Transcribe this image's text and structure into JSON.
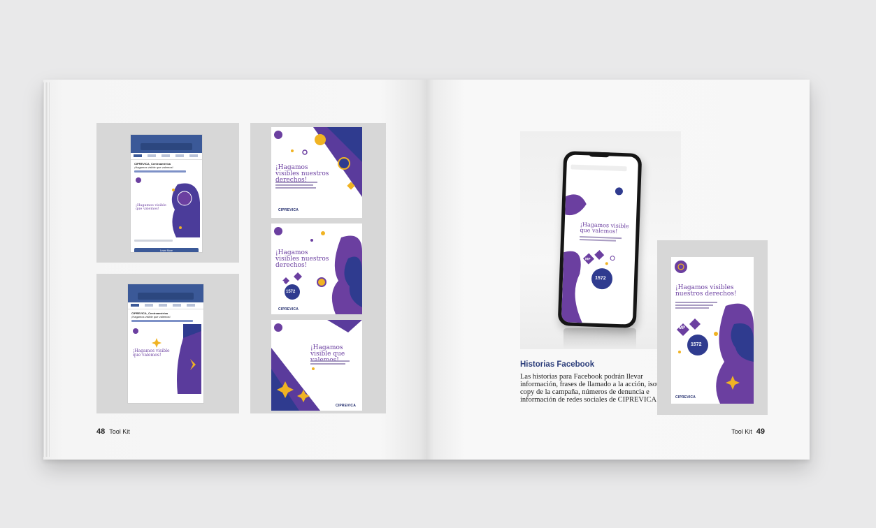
{
  "book": {
    "left_page": {
      "page_number": "48",
      "running_title": "Tool Kit",
      "fb_mock_1": {
        "account": "CIPREVICA_Centroamérica",
        "post_text": "¡Hagamos visible que valemos!",
        "headline": "¡Hagamos visible que valemos!",
        "button": "Learn More"
      },
      "fb_mock_2": {
        "account": "CIPREVICA_Centroamérica",
        "post_text": "¡Hagamos visible que valemos!",
        "headline": "¡Hagamos visible que valemos!"
      },
      "card_1": {
        "headline": "¡Hagamos visibles nuestros derechos!",
        "logo": "CIPREVICA"
      },
      "card_2": {
        "headline": "¡Hagamos visibles nuestros derechos!",
        "badge_1": "MP",
        "badge_2": "1572",
        "logo": "CIPREVICA"
      },
      "card_3": {
        "headline": "¡Hagamos visible que valemos!",
        "logo": "CIPREVICA"
      }
    },
    "right_page": {
      "page_number": "49",
      "running_title": "Tool Kit",
      "phone_screen": {
        "headline": "¡Hagamos visible que valemos!",
        "badge_1": "MP",
        "badge_2": "1572"
      },
      "caption_title": "Historias Facebook",
      "caption_body": "Las historias para Facebook podrán llevar información, frases de llamado a la acción, isotipo y copy de la campaña, números de denuncia e información de redes sociales de CIPREVICA.",
      "story": {
        "headline": "¡Hagamos visibles nuestros derechos!",
        "badge_1": "MP",
        "badge_2": "1572",
        "logo": "CIPREVICA"
      }
    }
  },
  "colors": {
    "purple": "#6b3fa0",
    "navy": "#2f3b8f",
    "gold": "#f0b323",
    "fb_blue": "#3b5998"
  }
}
